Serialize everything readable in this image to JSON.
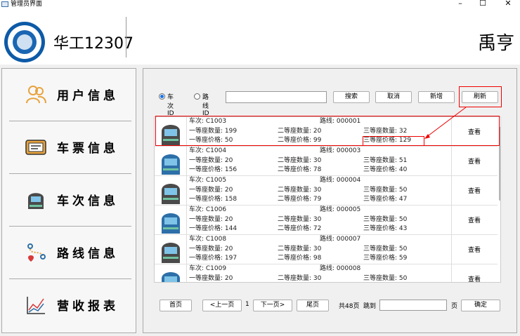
{
  "window": {
    "title": "管理员界面",
    "min": "–",
    "max": "☐",
    "close": "✕"
  },
  "header": {
    "app_name": "华工12307",
    "user_name": "禹亨"
  },
  "sidebar": {
    "items": [
      {
        "label": "用户信息",
        "icon": "users-icon"
      },
      {
        "label": "车票信息",
        "icon": "ticket-icon"
      },
      {
        "label": "车次信息",
        "icon": "train-icon"
      },
      {
        "label": "路线信息",
        "icon": "route-icon"
      },
      {
        "label": "营收报表",
        "icon": "chart-icon"
      }
    ]
  },
  "search": {
    "radio_train": "车次ID",
    "radio_route": "路线ID",
    "query_value": "",
    "search_label": "搜索",
    "cancel_label": "取消",
    "add_label": "新增",
    "refresh_label": "刷新"
  },
  "trains": [
    {
      "train": "车次: C1003",
      "route": "路线: 000001",
      "seat1": "一等座数量: 199",
      "seat2": "二等座数量: 20",
      "seat3": "三等座数量: 32",
      "price1": "一等座价格: 50",
      "price2": "二等座价格: 99",
      "price3": "三等座价格: 129",
      "view": "查看"
    },
    {
      "train": "车次: C1004",
      "route": "路线: 000003",
      "seat1": "一等座数量: 20",
      "seat2": "二等座数量: 30",
      "seat3": "三等座数量: 51",
      "price1": "一等座价格: 156",
      "price2": "二等座价格: 78",
      "price3": "三等座价格: 40",
      "view": "查看"
    },
    {
      "train": "车次: C1005",
      "route": "路线: 000004",
      "seat1": "一等座数量: 20",
      "seat2": "二等座数量: 30",
      "seat3": "三等座数量: 50",
      "price1": "一等座价格: 158",
      "price2": "二等座价格: 79",
      "price3": "三等座价格: 47",
      "view": "查看"
    },
    {
      "train": "车次: C1006",
      "route": "路线: 000005",
      "seat1": "一等座数量: 20",
      "seat2": "二等座数量: 30",
      "seat3": "三等座数量: 50",
      "price1": "一等座价格: 144",
      "price2": "二等座价格: 72",
      "price3": "三等座价格: 43",
      "view": "查看"
    },
    {
      "train": "车次: C1008",
      "route": "路线: 000007",
      "seat1": "一等座数量: 20",
      "seat2": "二等座数量: 30",
      "seat3": "三等座数量: 50",
      "price1": "一等座价格: 197",
      "price2": "二等座价格: 98",
      "price3": "三等座价格: 59",
      "view": "查看"
    },
    {
      "train": "车次: C1009",
      "route": "路线: 000008",
      "seat1": "一等座数量: 20",
      "seat2": "二等座数量: 30",
      "seat3": "三等座数量: 50",
      "price1": "",
      "price2": "",
      "price3": "",
      "view": "查看"
    }
  ],
  "pager": {
    "first": "首页",
    "prev": "<上一页",
    "current": "1",
    "next": "下一页>",
    "last": "尾页",
    "total": "共48页",
    "goto": "跳到",
    "goto_value": "",
    "unit": "页",
    "confirm": "确定"
  },
  "colors": {
    "highlight": "#e00000",
    "train_icon": "#2d6fa8",
    "radio_on": "#1a73e8"
  }
}
